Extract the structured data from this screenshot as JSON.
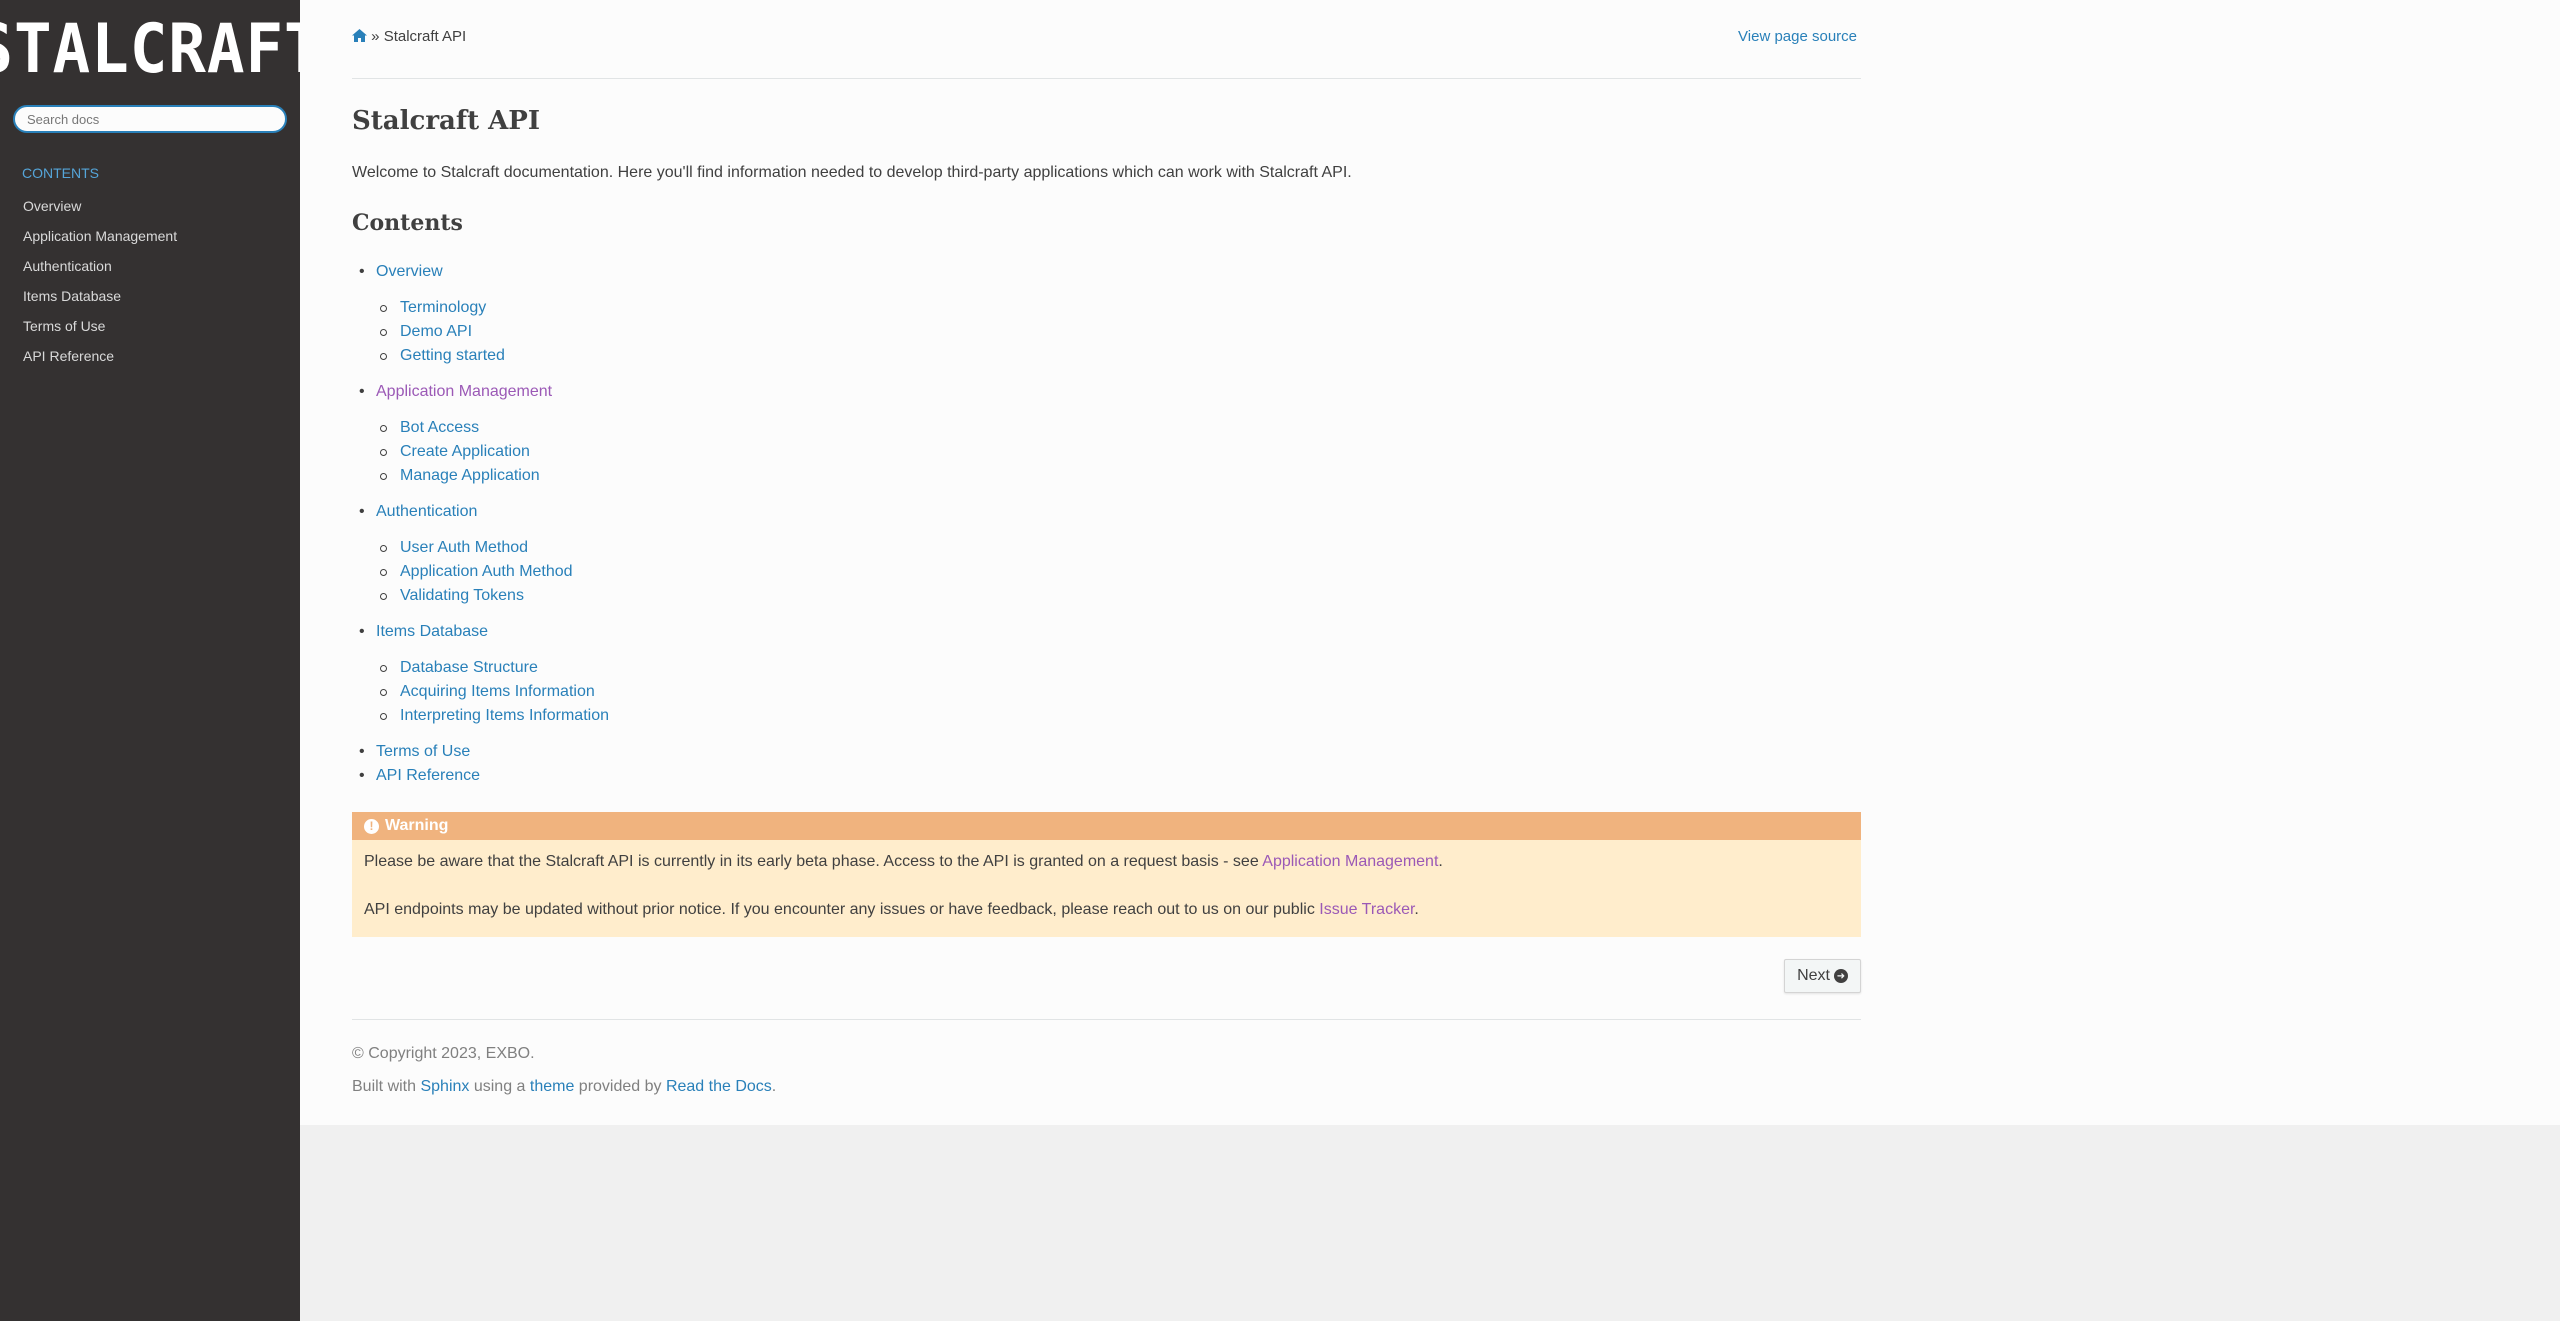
{
  "sidebar": {
    "logo_text": "STALCRAFT",
    "search_placeholder": "Search docs",
    "caption": "CONTENTS",
    "items": [
      {
        "label": "Overview"
      },
      {
        "label": "Application Management"
      },
      {
        "label": "Authentication"
      },
      {
        "label": "Items Database"
      },
      {
        "label": "Terms of Use"
      },
      {
        "label": "API Reference"
      }
    ]
  },
  "breadcrumb": {
    "home_icon": "home-icon",
    "separator": "»",
    "current": "Stalcraft API",
    "view_source": "View page source"
  },
  "page": {
    "title": "Stalcraft API",
    "intro": "Welcome to Stalcraft documentation. Here you'll find information needed to develop third-party applications which can work with Stalcraft API.",
    "contents_heading": "Contents"
  },
  "toc": [
    {
      "label": "Overview",
      "children": [
        "Terminology",
        "Demo API",
        "Getting started"
      ]
    },
    {
      "label": "Application Management",
      "children": [
        "Bot Access",
        "Create Application",
        "Manage Application"
      ]
    },
    {
      "label": "Authentication",
      "children": [
        "User Auth Method",
        "Application Auth Method",
        "Validating Tokens"
      ]
    },
    {
      "label": "Items Database",
      "children": [
        "Database Structure",
        "Acquiring Items Information",
        "Interpreting Items Information"
      ]
    },
    {
      "label": "Terms of Use",
      "children": []
    },
    {
      "label": "API Reference",
      "children": []
    }
  ],
  "warning": {
    "title": "Warning",
    "icon": "exclamation-circle-icon",
    "p1_text": "Please be aware that the Stalcraft API is currently in its early beta phase. Access to the API is granted on a request basis - see ",
    "p1_link": "Application Management",
    "p1_end": ".",
    "p2_text": "API endpoints may be updated without prior notice. If you encounter any issues or have feedback, please reach out to us on our public ",
    "p2_link": "Issue Tracker",
    "p2_end": "."
  },
  "next_button": {
    "label": "Next",
    "icon": "arrow-circle-right-icon"
  },
  "footer": {
    "copyright": "© Copyright 2023, EXBO.",
    "built_with": "Built with ",
    "sphinx": "Sphinx",
    "using_a": " using a ",
    "theme": "theme",
    "provided_by": " provided by ",
    "rtd": "Read the Docs",
    "end": "."
  },
  "colors": {
    "sidebar_bg": "#343131",
    "link": "#2980b9",
    "visited_link": "#9b59b6",
    "warning_header": "#f0b37e",
    "warning_body": "#ffedcc"
  }
}
